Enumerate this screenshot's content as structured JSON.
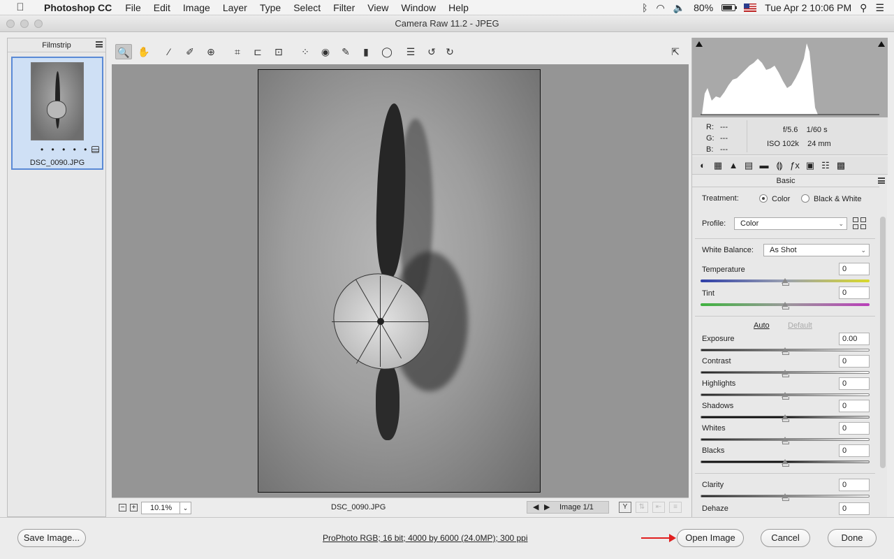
{
  "menubar": {
    "apple": "",
    "app_name": "Photoshop CC",
    "items": [
      "File",
      "Edit",
      "Image",
      "Layer",
      "Type",
      "Select",
      "Filter",
      "View",
      "Window",
      "Help"
    ],
    "status": {
      "battery": "80%",
      "datetime": "Tue Apr 2  10:06 PM"
    }
  },
  "window": {
    "title": "Camera Raw 11.2  -  JPEG"
  },
  "filmstrip": {
    "title": "Filmstrip",
    "thumbnail": {
      "dots": "• • • • •",
      "filename": "DSC_0090.JPG"
    }
  },
  "toolbar": {
    "tools": [
      {
        "name": "zoom-tool",
        "glyph": "🔍",
        "active": true
      },
      {
        "name": "hand-tool",
        "glyph": "✋"
      },
      {
        "name": "white-balance-tool",
        "glyph": "⁄"
      },
      {
        "name": "color-sampler-tool",
        "glyph": "⁄"
      },
      {
        "name": "targeted-adjustment-tool",
        "glyph": "⊕"
      },
      {
        "name": "crop-tool",
        "glyph": "⌗"
      },
      {
        "name": "straighten-tool",
        "glyph": "≏"
      },
      {
        "name": "transform-tool",
        "glyph": "⊡"
      },
      {
        "name": "spot-removal-tool",
        "glyph": "⁘"
      },
      {
        "name": "red-eye-tool",
        "glyph": "◉"
      },
      {
        "name": "adjustment-brush-tool",
        "glyph": "✎"
      },
      {
        "name": "graduated-filter-tool",
        "glyph": "▮"
      },
      {
        "name": "radial-filter-tool",
        "glyph": "◯"
      },
      {
        "name": "preferences-tool",
        "glyph": "☰"
      },
      {
        "name": "rotate-ccw-tool",
        "glyph": "↺"
      },
      {
        "name": "rotate-cw-tool",
        "glyph": "↻"
      }
    ]
  },
  "status_bar": {
    "zoom_out": "−",
    "zoom_in": "+",
    "zoom": "10.1%",
    "filename": "DSC_0090.JPG",
    "image_counter": "Image 1/1"
  },
  "readout": {
    "r_label": "R:",
    "r_value": "---",
    "g_label": "G:",
    "g_value": "---",
    "b_label": "B:",
    "b_value": "---",
    "aperture": "f/5.6",
    "shutter": "1/60 s",
    "iso": "ISO 102k",
    "focal": "24 mm"
  },
  "panel": {
    "title": "Basic",
    "treatment_label": "Treatment:",
    "treatment_color": "Color",
    "treatment_bw": "Black & White",
    "profile_label": "Profile:",
    "profile_value": "Color",
    "wb_label": "White Balance:",
    "wb_value": "As Shot",
    "auto": "Auto",
    "default": "Default",
    "sliders": [
      {
        "label": "Temperature",
        "value": "0"
      },
      {
        "label": "Tint",
        "value": "0"
      },
      {
        "label": "Exposure",
        "value": "0.00"
      },
      {
        "label": "Contrast",
        "value": "0"
      },
      {
        "label": "Highlights",
        "value": "0"
      },
      {
        "label": "Shadows",
        "value": "0"
      },
      {
        "label": "Whites",
        "value": "0"
      },
      {
        "label": "Blacks",
        "value": "0"
      },
      {
        "label": "Clarity",
        "value": "0"
      },
      {
        "label": "Dehaze",
        "value": "0"
      }
    ]
  },
  "bottom": {
    "save_image": "Save Image...",
    "info": "ProPhoto RGB; 16 bit; 4000 by 6000 (24.0MP); 300 ppi",
    "open_image": "Open Image",
    "cancel": "Cancel",
    "done": "Done"
  },
  "colors": {
    "accent": "#5a8ad6",
    "arrow": "#e01f1f"
  }
}
